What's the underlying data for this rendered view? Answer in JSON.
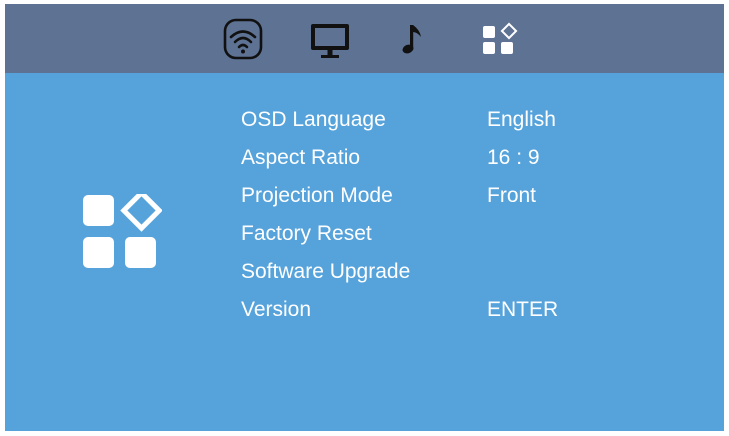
{
  "tabs": [
    {
      "icon": "wifi-icon"
    },
    {
      "icon": "monitor-icon"
    },
    {
      "icon": "music-note-icon"
    },
    {
      "icon": "settings-grid-icon",
      "selected": true
    }
  ],
  "panel_icon": "settings-grid-icon",
  "menu": {
    "items": [
      {
        "label": "OSD Language",
        "value": "English"
      },
      {
        "label": "Aspect Ratio",
        "value": "16 : 9"
      },
      {
        "label": "Projection Mode",
        "value": "Front"
      },
      {
        "label": "Factory Reset",
        "value": ""
      },
      {
        "label": "Software Upgrade",
        "value": ""
      },
      {
        "label": "Version",
        "value": "ENTER"
      }
    ]
  },
  "colors": {
    "background": "#56a3db",
    "topbar": "#5e7294",
    "icon_dark": "#111111",
    "text": "#ffffff"
  }
}
